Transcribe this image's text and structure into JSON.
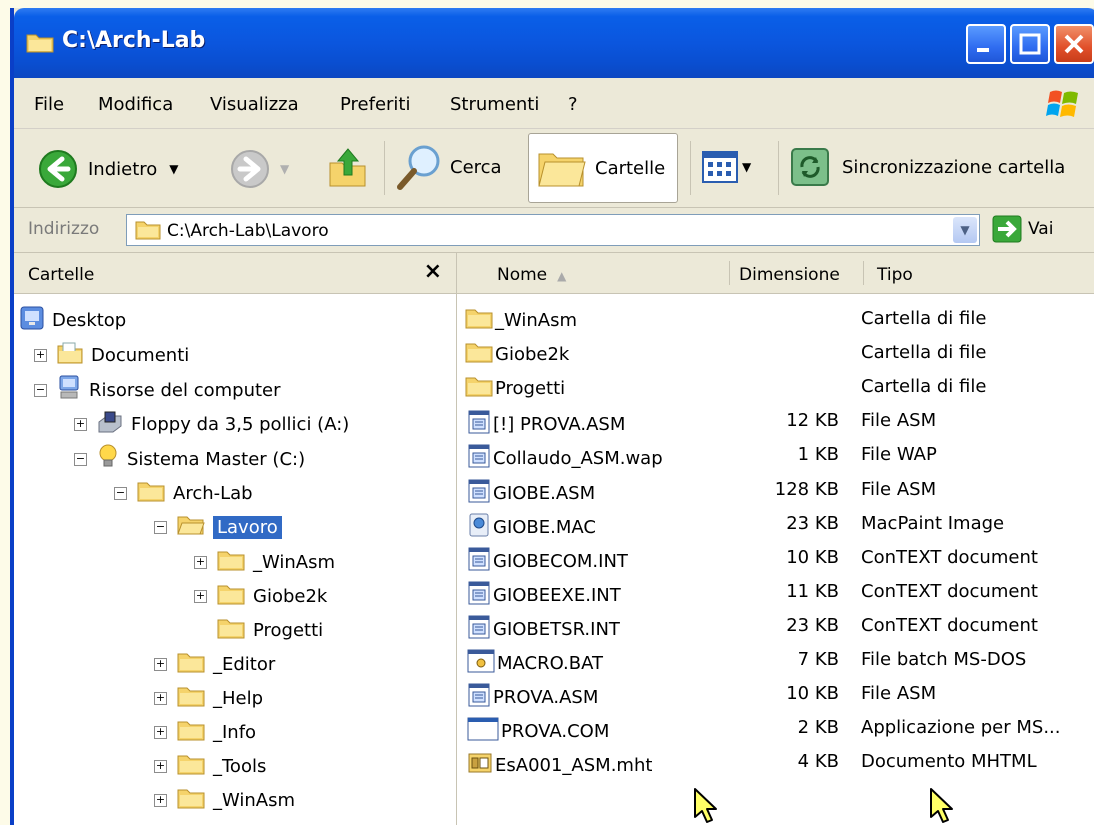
{
  "window": {
    "title": "C:\\Arch-Lab"
  },
  "menu": [
    "File",
    "Modifica",
    "Visualizza",
    "Preferiti",
    "Strumenti",
    "?"
  ],
  "toolbar": {
    "back_label": "Indietro",
    "search_label": "Cerca",
    "folders_label": "Cartelle",
    "sync_label": "Sincronizzazione cartella"
  },
  "address": {
    "label": "Indirizzo",
    "value": "C:\\Arch-Lab\\Lavoro",
    "go_label": "Vai"
  },
  "folders_pane": {
    "title": "Cartelle",
    "close": "×",
    "tree": [
      {
        "label": "Desktop",
        "icon": "desktop-icon",
        "exp": "none"
      },
      {
        "label": "Documenti",
        "icon": "documents-folder-icon",
        "exp": "+"
      },
      {
        "label": "Risorse del computer",
        "icon": "my-computer-icon",
        "exp": "−"
      },
      {
        "label": "Floppy da 3,5 pollici (A:)",
        "icon": "floppy-drive-icon",
        "exp": "+"
      },
      {
        "label": "Sistema Master (C:)",
        "icon": "hard-drive-icon",
        "exp": "−"
      },
      {
        "label": "Arch-Lab",
        "icon": "folder-icon",
        "exp": "−"
      },
      {
        "label": "Lavoro",
        "icon": "open-folder-icon",
        "exp": "−",
        "selected": true
      },
      {
        "label": "_WinAsm",
        "icon": "folder-icon",
        "exp": "+"
      },
      {
        "label": "Giobe2k",
        "icon": "folder-icon",
        "exp": "+"
      },
      {
        "label": "Progetti",
        "icon": "folder-icon",
        "exp": "none"
      },
      {
        "label": "_Editor",
        "icon": "folder-icon",
        "exp": "+"
      },
      {
        "label": "_Help",
        "icon": "folder-icon",
        "exp": "+"
      },
      {
        "label": "_Info",
        "icon": "folder-icon",
        "exp": "+"
      },
      {
        "label": "_Tools",
        "icon": "folder-icon",
        "exp": "+"
      },
      {
        "label": "_WinAsm",
        "icon": "folder-icon",
        "exp": "+"
      }
    ]
  },
  "file_list": {
    "columns": {
      "name": "Nome",
      "size": "Dimensione",
      "type": "Tipo"
    },
    "rows": [
      {
        "name": "_WinAsm",
        "size": "",
        "type": "Cartella di file",
        "icon": "folder-icon"
      },
      {
        "name": "Giobe2k",
        "size": "",
        "type": "Cartella di file",
        "icon": "folder-icon"
      },
      {
        "name": "Progetti",
        "size": "",
        "type": "Cartella di file",
        "icon": "folder-icon"
      },
      {
        "name": "[!] PROVA.ASM",
        "size": "12 KB",
        "type": "File ASM",
        "icon": "text-file-icon"
      },
      {
        "name": "Collaudo_ASM.wap",
        "size": "1 KB",
        "type": "File WAP",
        "icon": "text-file-icon"
      },
      {
        "name": "GIOBE.ASM",
        "size": "128 KB",
        "type": "File ASM",
        "icon": "text-file-icon"
      },
      {
        "name": "GIOBE.MAC",
        "size": "23 KB",
        "type": "MacPaint Image",
        "icon": "image-file-icon"
      },
      {
        "name": "GIOBECOM.INT",
        "size": "10 KB",
        "type": "ConTEXT document",
        "icon": "text-file-icon"
      },
      {
        "name": "GIOBEEXE.INT",
        "size": "11 KB",
        "type": "ConTEXT document",
        "icon": "text-file-icon"
      },
      {
        "name": "GIOBETSR.INT",
        "size": "23 KB",
        "type": "ConTEXT document",
        "icon": "text-file-icon"
      },
      {
        "name": "MACRO.BAT",
        "size": "7 KB",
        "type": "File batch MS-DOS",
        "icon": "batch-file-icon"
      },
      {
        "name": "PROVA.ASM",
        "size": "10 KB",
        "type": "File ASM",
        "icon": "text-file-icon"
      },
      {
        "name": "PROVA.COM",
        "size": "2 KB",
        "type": "Applicazione per MS...",
        "icon": "application-icon"
      },
      {
        "name": "EsA001_ASM.mht",
        "size": "4 KB",
        "type": "Documento MHTML",
        "icon": "mhtml-file-icon"
      }
    ]
  },
  "colors": {
    "titlebar": "#0a56de",
    "selection": "#316ac5",
    "folder": "#f5d36b"
  }
}
